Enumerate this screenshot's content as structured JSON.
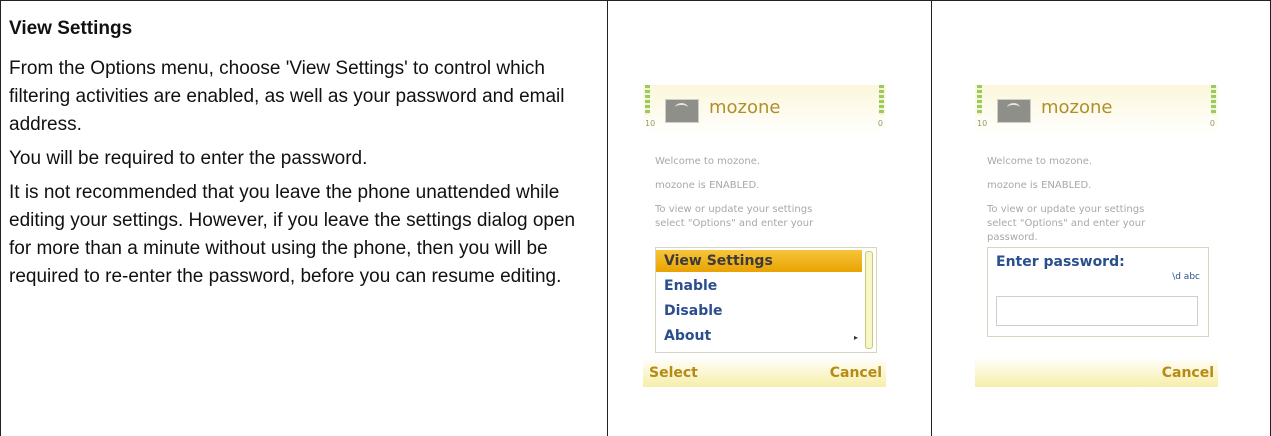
{
  "section": {
    "heading": "View Settings",
    "paragraphs": [
      "From the Options menu, choose 'View Settings' to control which filtering activities are enabled, as well as your password and email address.",
      "You will be required to enter the password.",
      "It is not recommended that you leave the phone unattended while editing your settings. However, if you leave the settings dialog open for more than a minute without using the phone, then you will be required to re-enter the password, before you can resume editing."
    ]
  },
  "screen1": {
    "app_title": "mozone",
    "signal_num": "10",
    "battery_num": "0",
    "lines": [
      "Welcome to mozone.",
      "mozone is ENABLED.",
      "To view or update your settings",
      "select \"Options\" and enter your"
    ],
    "menu_items": [
      "View Settings",
      "Enable",
      "Disable",
      "About"
    ],
    "softkey_left": "Select",
    "softkey_right": "Cancel"
  },
  "screen2": {
    "app_title": "mozone",
    "signal_num": "10",
    "battery_num": "0",
    "lines": [
      "Welcome to mozone.",
      "mozone is ENABLED.",
      "To view or update your settings",
      "select \"Options\" and enter your",
      "password."
    ],
    "password_label": "Enter password:",
    "input_mode": "\\d abc",
    "softkey_right": "Cancel"
  },
  "colors": {
    "menu_selected": "#f0b41c",
    "menu_text": "#2a4f8c",
    "softkey_text": "#b58a15",
    "title_text": "#b08f2a"
  }
}
